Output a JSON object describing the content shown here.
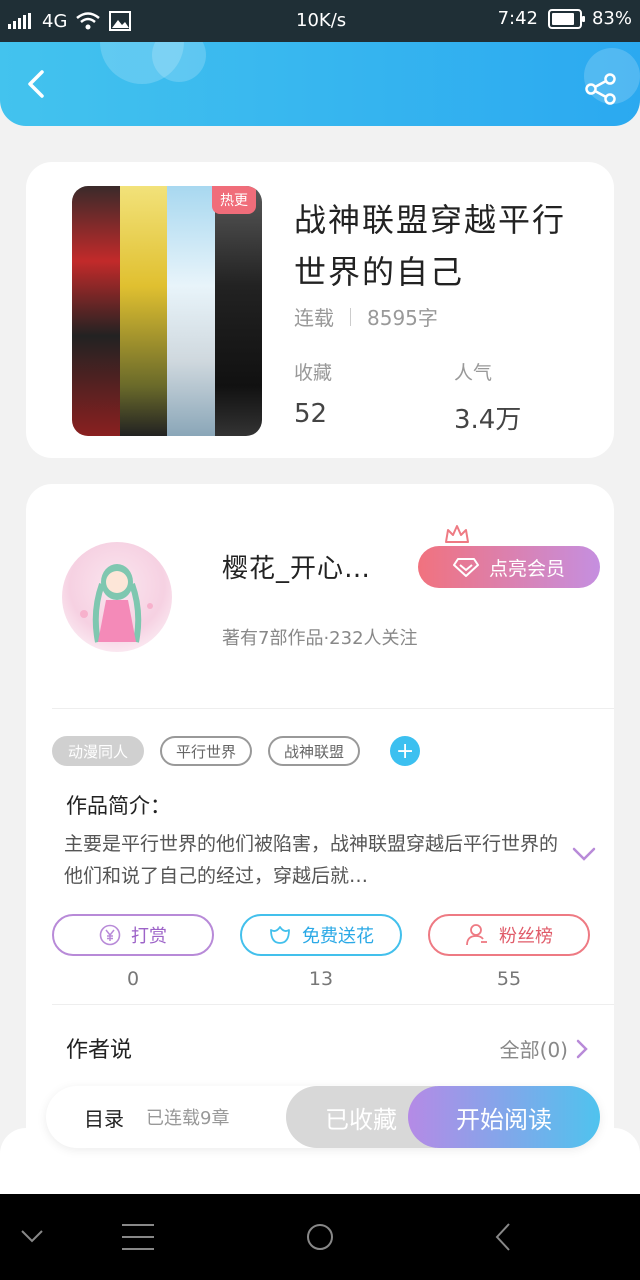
{
  "status_bar": {
    "network": "4G",
    "speed": "10K/s",
    "time": "7:42",
    "battery": "83%",
    "battery_level": 0.83
  },
  "book": {
    "hot_tag": "热更",
    "title": "战神联盟穿越平行世界的自己",
    "status": "连载",
    "words": "8595字",
    "favorites_label": "收藏",
    "favorites": "52",
    "popularity_label": "人气",
    "popularity": "3.4万"
  },
  "author": {
    "name": "樱花_开心…",
    "info": "著有7部作品·232人关注",
    "vip_label": "点亮会员"
  },
  "tags": [
    "动漫同人",
    "平行世界",
    "战神联盟"
  ],
  "intro": {
    "title": "作品简介：",
    "text": "主要是平行世界的他们被陷害，战神联盟穿越后平行世界的他们和说了自己的经过，穿越后就…"
  },
  "actions": [
    {
      "label": "打赏",
      "count": "0",
      "icon": "yuan-icon"
    },
    {
      "label": "免费送花",
      "count": "13",
      "icon": "flower-icon"
    },
    {
      "label": "粉丝榜",
      "count": "55",
      "icon": "user-icon"
    }
  ],
  "author_says": {
    "title": "作者说",
    "all": "全部(0)"
  },
  "bottom_bar": {
    "catalog": "目录",
    "catalog_status": "已连载9章",
    "collected": "已收藏",
    "start": "开始阅读"
  },
  "colors": {
    "header": "#2ba9f0",
    "accent_pink": "#f1727e",
    "accent_purple": "#b58ae6",
    "accent_blue": "#43c0ec"
  }
}
